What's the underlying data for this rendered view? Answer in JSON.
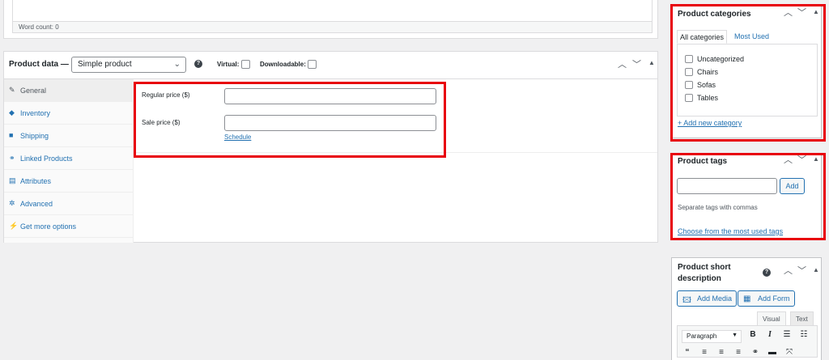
{
  "editor": {
    "word_count": "Word count: 0"
  },
  "product_data": {
    "title": "Product data —",
    "type_select": "Simple product",
    "help_icon": "?",
    "virtual_label": "Virtual:",
    "downloadable_label": "Downloadable:",
    "tabs": [
      {
        "label": "General",
        "icon": "wrench-icon",
        "glyph": "✎"
      },
      {
        "label": "Inventory",
        "icon": "tag-icon",
        "glyph": "◆"
      },
      {
        "label": "Shipping",
        "icon": "truck-icon",
        "glyph": "■"
      },
      {
        "label": "Linked Products",
        "icon": "link-icon",
        "glyph": "⚭"
      },
      {
        "label": "Attributes",
        "icon": "list-icon",
        "glyph": "▤"
      },
      {
        "label": "Advanced",
        "icon": "gear-icon",
        "glyph": "✲"
      },
      {
        "label": "Get more options",
        "icon": "plugin-icon",
        "glyph": "⚡"
      }
    ],
    "regular_price_label": "Regular price ($)",
    "sale_price_label": "Sale price ($)",
    "schedule_link": "Schedule"
  },
  "categories": {
    "title": "Product categories",
    "tab_all": "All categories",
    "tab_most_used": "Most Used",
    "items": [
      "Uncategorized",
      "Chairs",
      "Sofas",
      "Tables"
    ],
    "add_new": "+ Add new category"
  },
  "tags": {
    "title": "Product tags",
    "add_button": "Add",
    "hint": "Separate tags with commas",
    "choose_link": "Choose from the most used tags"
  },
  "short_description": {
    "title_line1": "Product short",
    "title_line2": "description",
    "add_media": "Add Media",
    "add_form": "Add Form",
    "tab_visual": "Visual",
    "tab_text": "Text",
    "paragraph_select": "Paragraph"
  },
  "colors": {
    "highlight": "#e8000b",
    "link": "#2271b1"
  }
}
